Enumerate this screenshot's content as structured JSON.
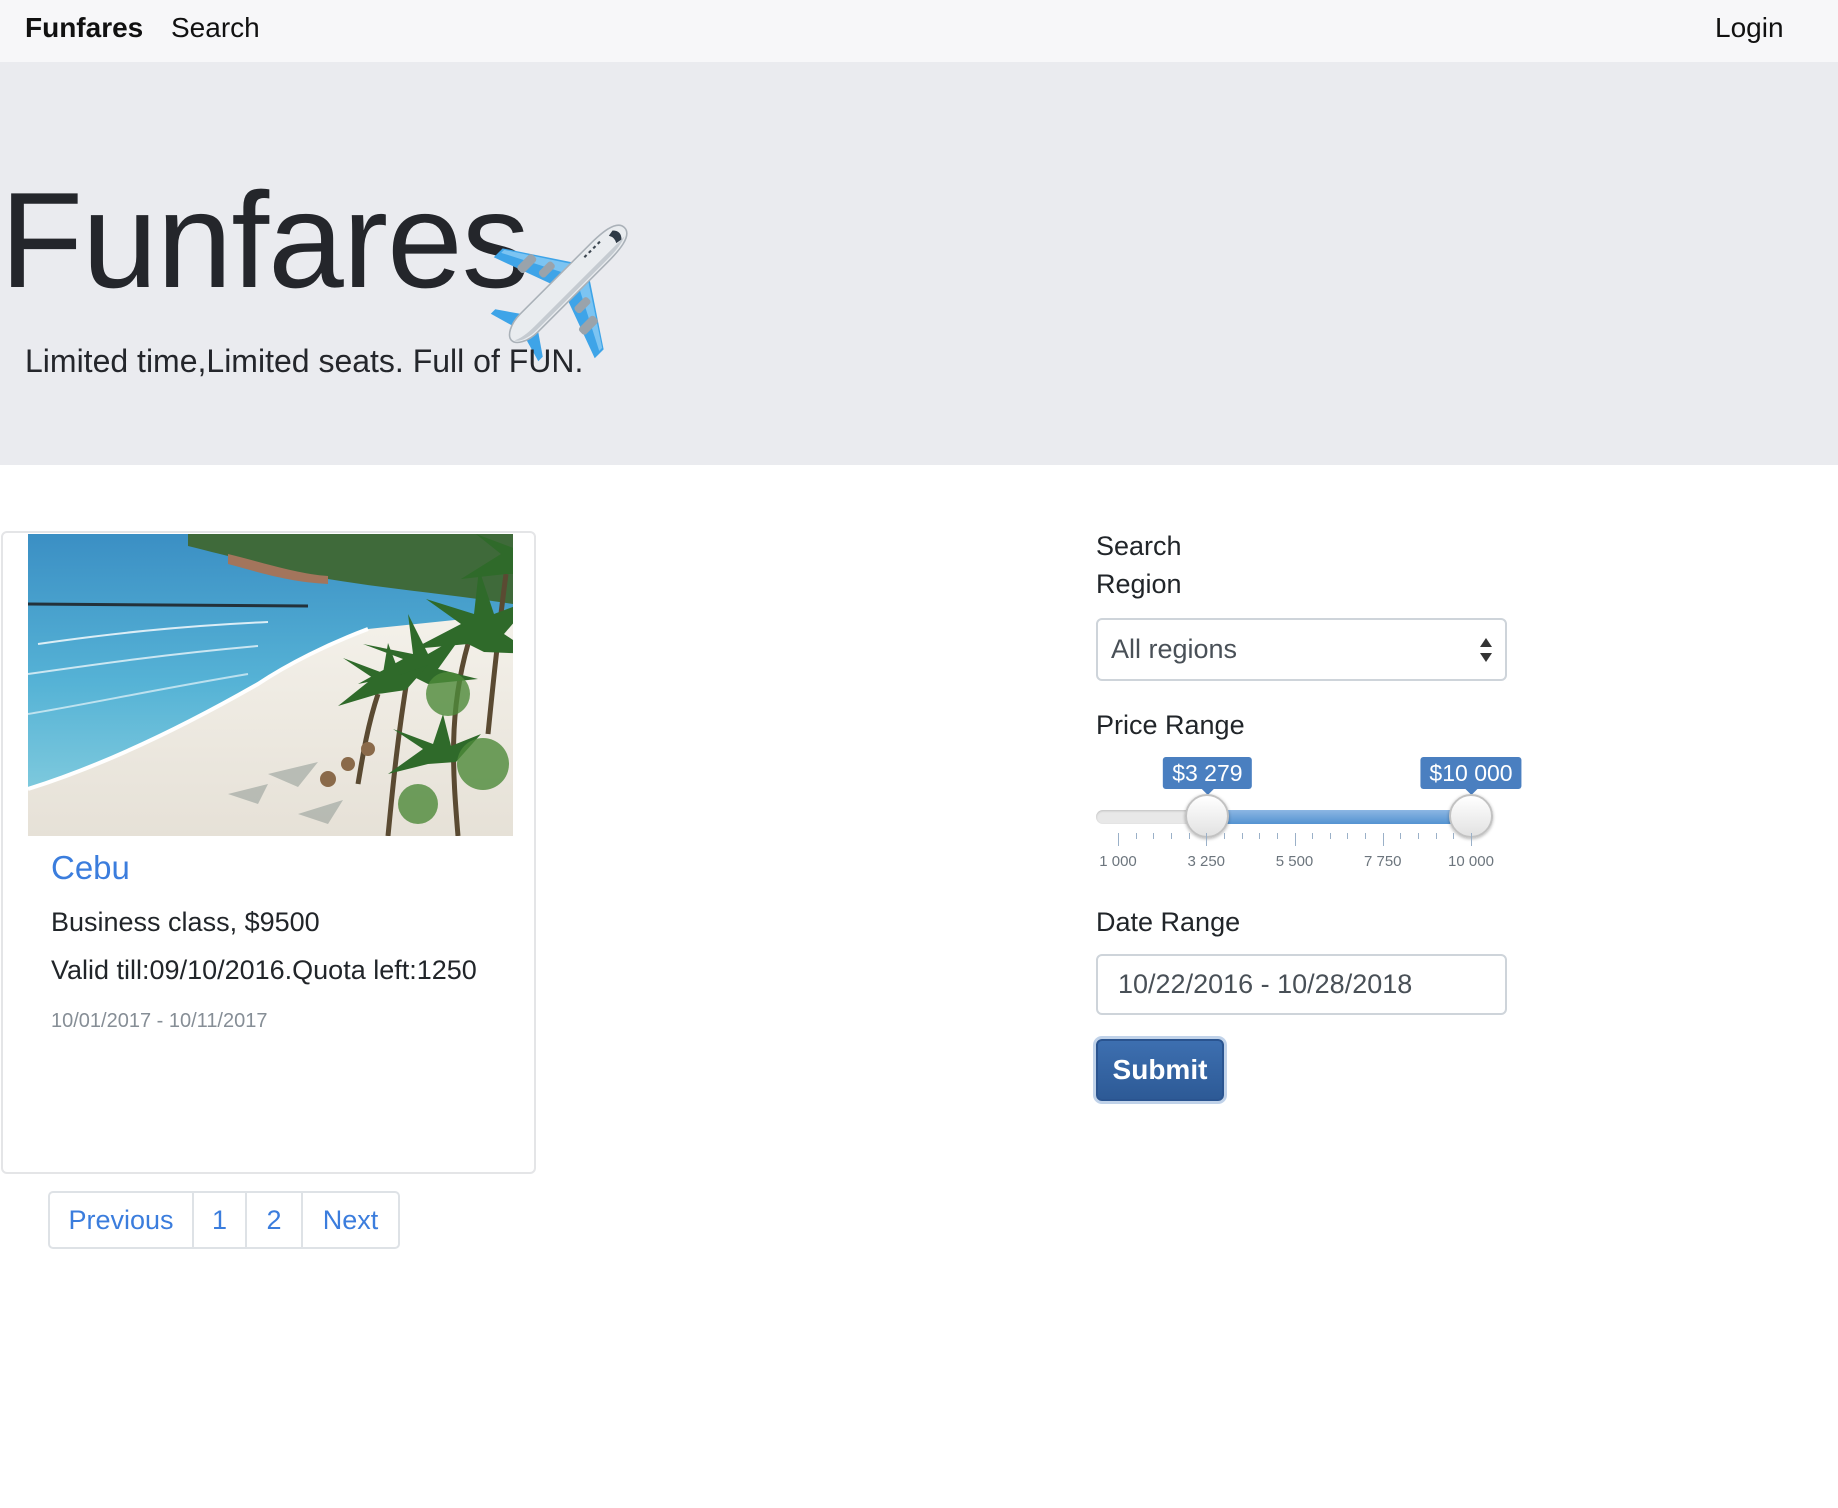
{
  "navbar": {
    "brand": "Funfares",
    "search_link": "Search",
    "login_link": "Login"
  },
  "hero": {
    "title": "Funfares",
    "icon": "airplane-icon",
    "subtitle": "Limited time,Limited seats. Full of FUN."
  },
  "card": {
    "image": "beach-photo",
    "title": "Cebu",
    "line1": "Business class, $9500",
    "line2": "Valid till:09/10/2016.Quota left:1250",
    "dates": "10/01/2017 - 10/11/2017"
  },
  "pagination": {
    "items": [
      "Previous",
      "1",
      "2",
      "Next"
    ]
  },
  "search_form": {
    "search_label": "Search",
    "region_label": "Region",
    "region_value": "All regions",
    "price_label": "Price Range",
    "price_min_value": 3279,
    "price_max_value": 10000,
    "price_min_text": "$3 279",
    "price_max_text": "$10 000",
    "price_scale_min": 1000,
    "price_scale_max": 10000,
    "tick_labels": [
      "1 000",
      "3 250",
      "5 500",
      "7 750",
      "10 000"
    ],
    "date_label": "Date Range",
    "date_value": "10/22/2016 - 10/28/2018",
    "submit_label": "Submit"
  },
  "colors": {
    "link": "#3b7ddd",
    "slider_accent": "#4a7fc0",
    "hero_bg": "#eaebef",
    "navbar_bg": "#f7f7f9",
    "submit_bg": "#2d5a96"
  }
}
